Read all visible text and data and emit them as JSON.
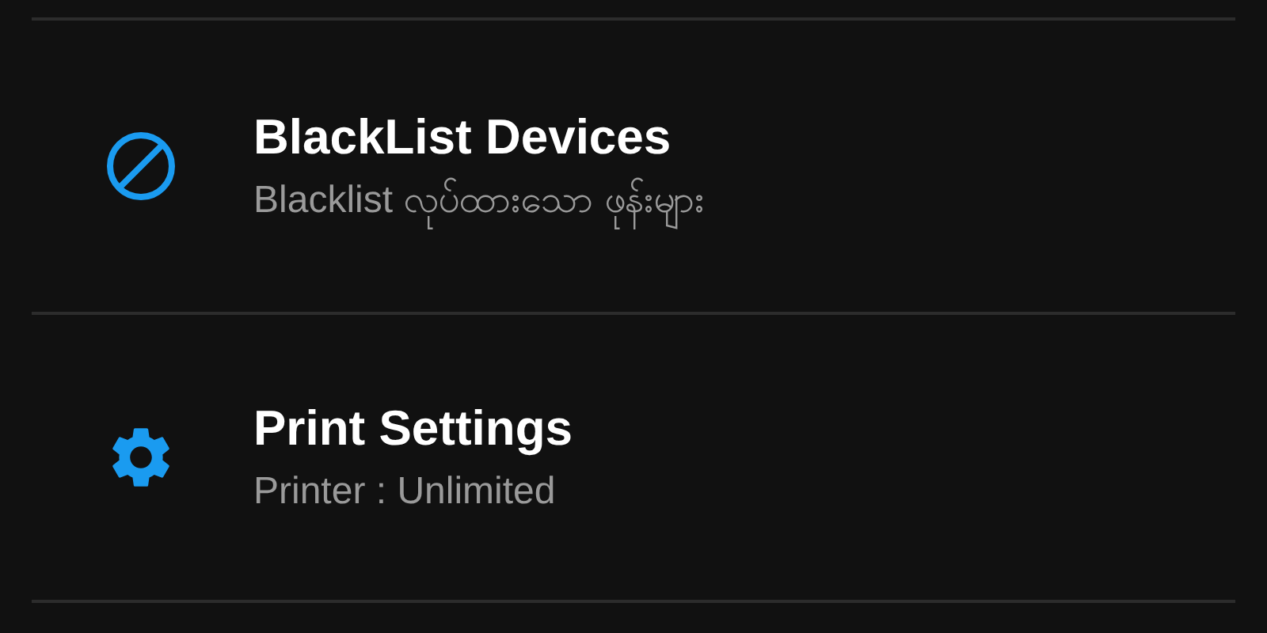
{
  "settings": [
    {
      "kind": "block",
      "title": "BlackList Devices",
      "subtitle": "Blacklist လုပ်ထားသော ဖုန်းများ"
    },
    {
      "kind": "gear",
      "title": "Print Settings",
      "subtitle": "Printer : Unlimited"
    }
  ]
}
